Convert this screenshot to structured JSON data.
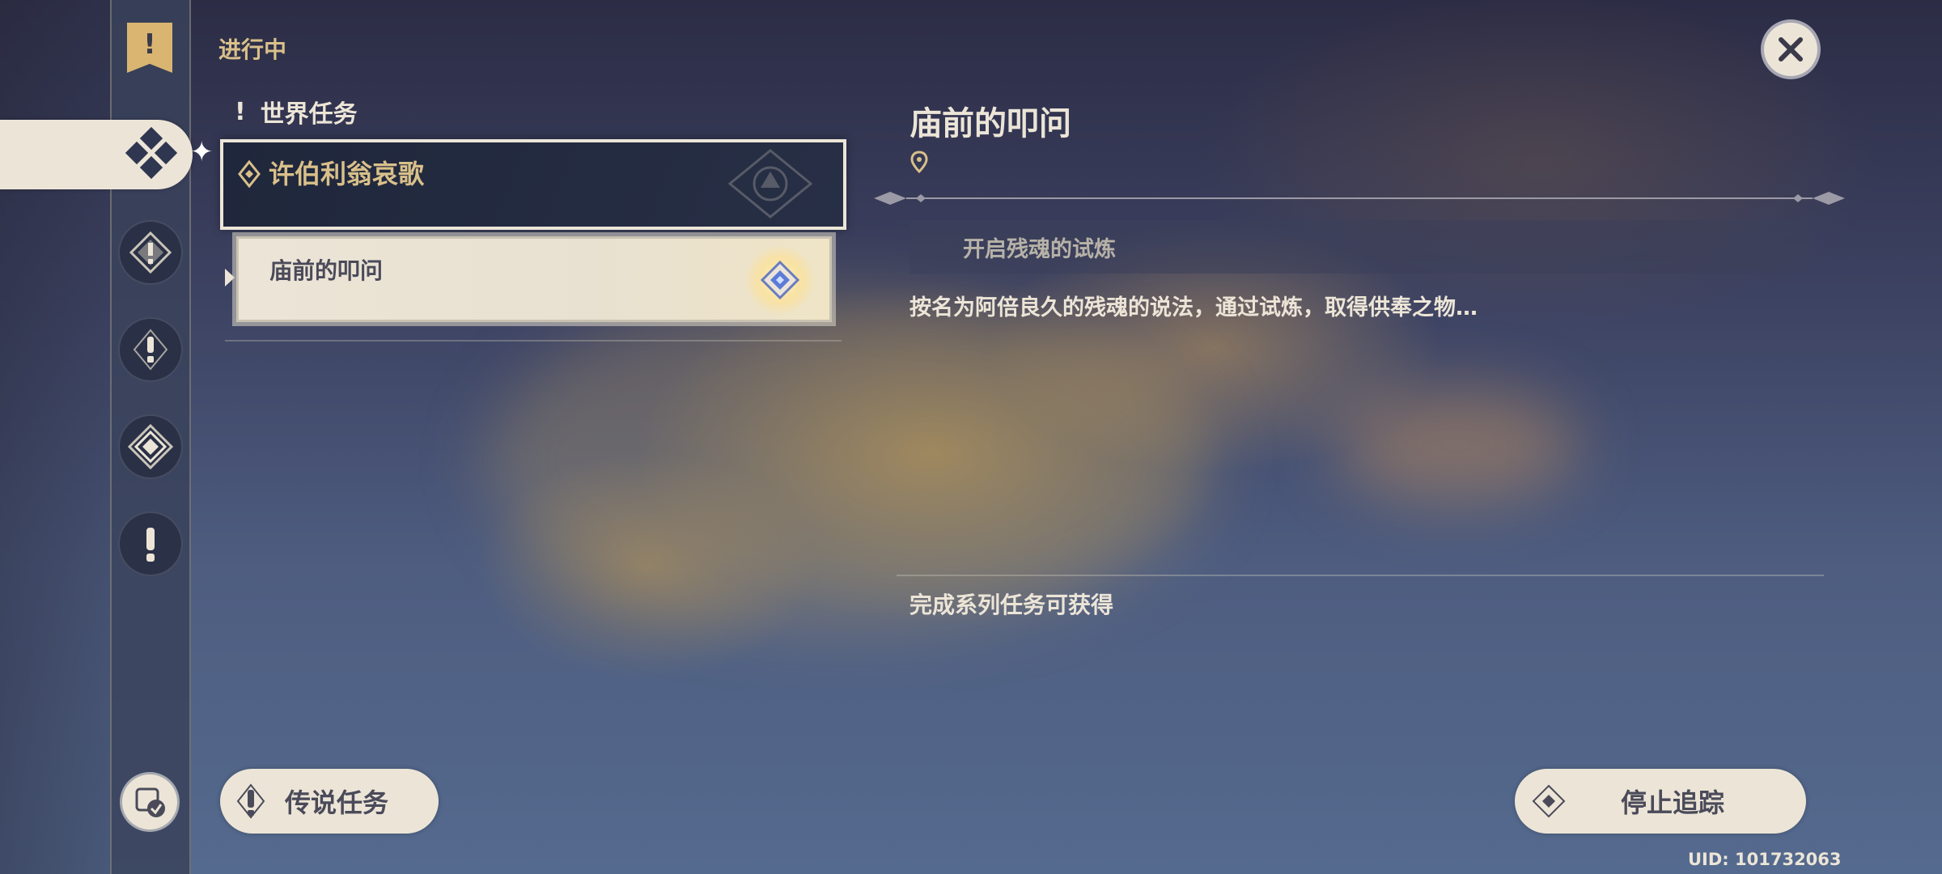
{
  "quest_list": {
    "heading": "进行中",
    "category_label": "世界任务",
    "active_quest": {
      "title": "许伯利翁哀歌",
      "sub_quests": [
        {
          "title": "庙前的叩问",
          "tracked": true
        }
      ]
    },
    "legend_button_label": "传说任务"
  },
  "sidebar": {
    "items": [
      {
        "icon": "quest-banner-icon"
      },
      {
        "icon": "world-quest-diamond-icon",
        "selected": true
      },
      {
        "icon": "archon-quest-icon"
      },
      {
        "icon": "story-quest-icon"
      },
      {
        "icon": "commission-quest-icon"
      },
      {
        "icon": "event-quest-icon"
      }
    ],
    "bottom_item": {
      "icon": "quest-book-check-icon"
    }
  },
  "detail": {
    "title": "庙前的叩问",
    "objective": "开启残魂的试炼",
    "description": "按名为阿倍良久的残魂的说法，通过试炼，取得供奉之物…",
    "reward_label": "完成系列任务可获得",
    "track_button_label": "停止追踪"
  },
  "footer": {
    "uid": "UID: 101732063"
  },
  "colors": {
    "cream": "#ece5d7",
    "gold": "#d9c08a",
    "dark_text": "#4a4a5a",
    "rail_bg": "#3a425a"
  }
}
